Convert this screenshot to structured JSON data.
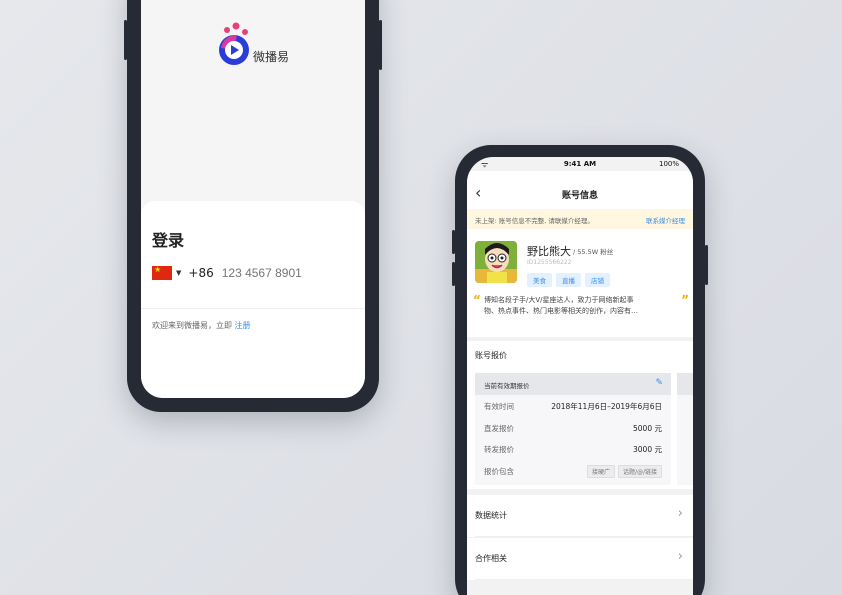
{
  "phone1": {
    "logo_text": "微播易",
    "login_title": "登录",
    "country_code": "+86",
    "phone_placeholder": "123 4567 8901",
    "welcome_text": "欢迎来到微播易，立即 ",
    "register_link": "注册"
  },
  "phone2": {
    "status": {
      "time": "9:41 AM",
      "battery": "100%"
    },
    "nav_title": "账号信息",
    "notice": {
      "message": "未上架: 账号信息不完整, 请联媒介经理。",
      "link": "联系媒介经理"
    },
    "profile": {
      "name": "野比熊大",
      "fans": "/ 55.5W 粉丝",
      "id": "ID1255566222",
      "tags": [
        "美食",
        "直播",
        "店铺"
      ],
      "bio_line1": "博知名段子手/大V/星座达人，致力于网络新起事",
      "bio_line2": "物、热点事件、热门电影等相关的创作，内容有…"
    },
    "quote_section_title": "账号报价",
    "quote_card": {
      "header": "当前有效期报价",
      "rows": [
        {
          "label": "有效时间",
          "value": "2018年11月6日–2019年6月6日"
        },
        {
          "label": "直发报价",
          "value": "5000 元"
        },
        {
          "label": "转发报价",
          "value": "3000 元"
        }
      ],
      "include_label": "报价包含",
      "include_pills": [
        "接硬广",
        "话题/@/链接"
      ]
    },
    "menu": [
      {
        "label": "数据统计"
      },
      {
        "label": "合作相关"
      }
    ]
  },
  "colors": {
    "accent": "#3b8eea",
    "frame": "#262a35",
    "notice_bg": "#fff7e0"
  }
}
